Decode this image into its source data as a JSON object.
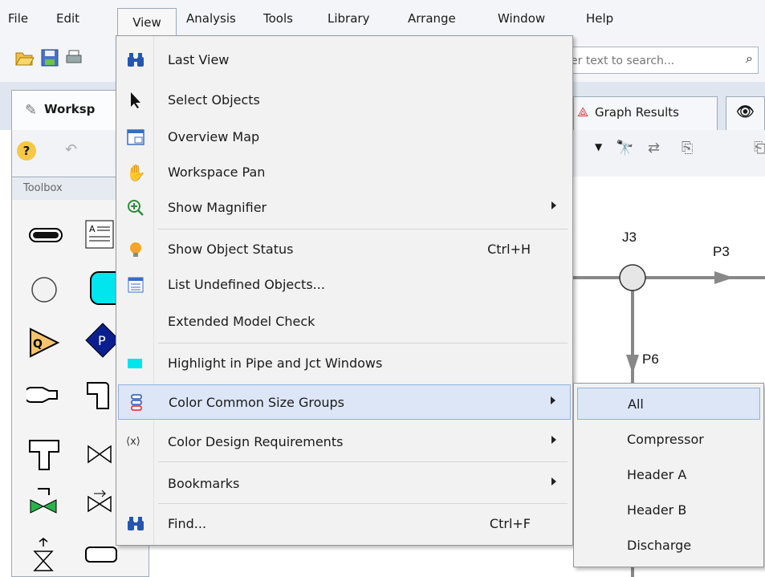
{
  "menubar": {
    "items": [
      "File",
      "Edit",
      "View",
      "Analysis",
      "Tools",
      "Library",
      "Arrange",
      "Window",
      "Help"
    ],
    "active": "View"
  },
  "search": {
    "placeholder": "er text to search..."
  },
  "tabs": [
    {
      "label": "Worksp",
      "icon": "workspace-icon"
    },
    {
      "label": "Graph Results",
      "icon": "graph-results-icon"
    }
  ],
  "toolbox": {
    "title": "Toolbox"
  },
  "workspace": {
    "labels": {
      "junction": "J3",
      "pipe_right": "P3",
      "pipe_down": "P6"
    }
  },
  "view_menu": {
    "items": [
      {
        "label": "Last View",
        "icon": "binoculars-icon",
        "shortcut": ""
      },
      {
        "label": "Select Objects",
        "icon": "cursor-arrow-icon",
        "shortcut": ""
      },
      {
        "label": "Overview Map",
        "icon": "overview-map-icon",
        "shortcut": ""
      },
      {
        "label": "Workspace Pan",
        "icon": "hand-pan-icon",
        "shortcut": ""
      },
      {
        "label": "Show Magnifier",
        "icon": "magnifier-icon",
        "shortcut": ""
      },
      {
        "label": "Show Object Status",
        "icon": "lightbulb-icon",
        "shortcut": "Ctrl+H"
      },
      {
        "label": "List Undefined Objects...",
        "icon": "list-icon",
        "shortcut": ""
      },
      {
        "label": "Extended Model Check",
        "icon": "",
        "shortcut": ""
      },
      {
        "label": "Highlight in Pipe and Jct Windows",
        "icon": "cyan-square-icon",
        "shortcut": ""
      },
      {
        "label": "Color Common Size Groups",
        "icon": "size-groups-icon",
        "shortcut": ""
      },
      {
        "label": "Color Design Requirements",
        "icon": "design-requirements-icon",
        "shortcut": ""
      },
      {
        "label": "Bookmarks",
        "icon": "",
        "shortcut": ""
      },
      {
        "label": "Find...",
        "icon": "binoculars-icon",
        "shortcut": "Ctrl+F"
      }
    ]
  },
  "submenu": {
    "items": [
      "All",
      "Compressor",
      "Header A",
      "Header B",
      "Discharge"
    ],
    "highlighted": "All"
  },
  "colors": {
    "menu_highlight": "#dce6f6",
    "pipe": "#888888",
    "cyan": "#00e5ee",
    "pump_blue": "#0a1f8f",
    "compressor_orange": "#f5c36b"
  }
}
